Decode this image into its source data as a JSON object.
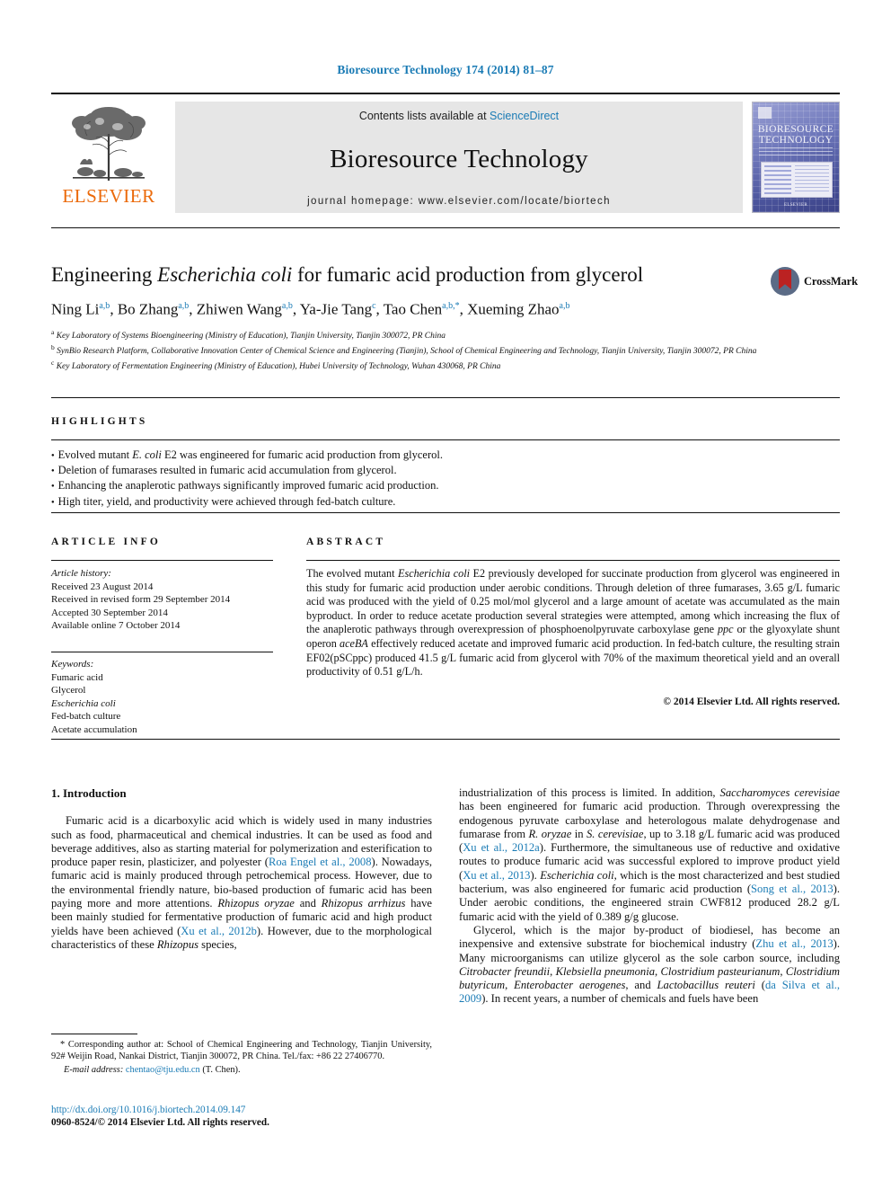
{
  "running_head": "Bioresource Technology 174 (2014) 81–87",
  "masthead": {
    "publisher": "ELSEVIER",
    "contents_prefix": "Contents lists available at ",
    "contents_link": "ScienceDirect",
    "journal_name": "Bioresource Technology",
    "homepage": "journal homepage: www.elsevier.com/locate/biortech",
    "cover": {
      "title_line1": "BIORESOURCE",
      "title_line2": "TECHNOLOGY",
      "footer": "ELSEVIER"
    }
  },
  "article": {
    "title_pre": "Engineering ",
    "title_italic": "Escherichia coli",
    "title_post": " for fumaric acid production from glycerol",
    "crossmark_label": "CrossMark",
    "authors": "Ning Li a,b, Bo Zhang a,b, Zhiwen Wang a,b, Ya-Jie Tang c, Tao Chen a,b,*, Xueming Zhao a,b",
    "affiliations": [
      "a Key Laboratory of Systems Bioengineering (Ministry of Education), Tianjin University, Tianjin 300072, PR China",
      "b SynBio Research Platform, Collaborative Innovation Center of Chemical Science and Engineering (Tianjin), School of Chemical Engineering and Technology, Tianjin University, Tianjin 300072, PR China",
      "c Key Laboratory of Fermentation Engineering (Ministry of Education), Hubei University of Technology, Wuhan 430068, PR China"
    ]
  },
  "highlights": {
    "heading": "HIGHLIGHTS",
    "items": [
      "Evolved mutant E. coli E2 was engineered for fumaric acid production from glycerol.",
      "Deletion of fumarases resulted in fumaric acid accumulation from glycerol.",
      "Enhancing the anaplerotic pathways significantly improved fumaric acid production.",
      "High titer, yield, and productivity were achieved through fed-batch culture."
    ]
  },
  "article_info": {
    "heading": "ARTICLE INFO",
    "history_label": "Article history:",
    "history": [
      "Received 23 August 2014",
      "Received in revised form 29 September 2014",
      "Accepted 30 September 2014",
      "Available online 7 October 2014"
    ],
    "keywords_label": "Keywords:",
    "keywords": [
      "Fumaric acid",
      "Glycerol",
      "Escherichia coli",
      "Fed-batch culture",
      "Acetate accumulation"
    ]
  },
  "abstract": {
    "heading": "ABSTRACT",
    "text": "The evolved mutant Escherichia coli E2 previously developed for succinate production from glycerol was engineered in this study for fumaric acid production under aerobic conditions. Through deletion of three fumarases, 3.65 g/L fumaric acid was produced with the yield of 0.25 mol/mol glycerol and a large amount of acetate was accumulated as the main byproduct. In order to reduce acetate production several strategies were attempted, among which increasing the flux of the anaplerotic pathways through overexpression of phosphoenolpyruvate carboxylase gene ppc or the glyoxylate shunt operon aceBA effectively reduced acetate and improved fumaric acid production. In fed-batch culture, the resulting strain EF02(pSCppc) produced 41.5 g/L fumaric acid from glycerol with 70% of the maximum theoretical yield and an overall productivity of 0.51 g/L/h.",
    "copyright": "© 2014 Elsevier Ltd. All rights reserved."
  },
  "introduction": {
    "heading": "1. Introduction",
    "left_paragraph": "Fumaric acid is a dicarboxylic acid which is widely used in many industries such as food, pharmaceutical and chemical industries. It can be used as food and beverage additives, also as starting material for polymerization and esterification to produce paper resin, plasticizer, and polyester (Roa Engel et al., 2008). Nowadays, fumaric acid is mainly produced through petrochemical process. However, due to the environmental friendly nature, bio-based production of fumaric acid has been paying more and more attentions. Rhizopus oryzae and Rhizopus arrhizus have been mainly studied for fermentative production of fumaric acid and high product yields have been achieved (Xu et al., 2012b). However, due to the morphological characteristics of these Rhizopus species,",
    "right_paragraph_1": "industrialization of this process is limited. In addition, Saccharomyces cerevisiae has been engineered for fumaric acid production. Through overexpressing the endogenous pyruvate carboxylase and heterologous malate dehydrogenase and fumarase from R. oryzae in S. cerevisiae, up to 3.18 g/L fumaric acid was produced (Xu et al., 2012a). Furthermore, the simultaneous use of reductive and oxidative routes to produce fumaric acid was successful explored to improve product yield (Xu et al., 2013). Escherichia coli, which is the most characterized and best studied bacterium, was also engineered for fumaric acid production (Song et al., 2013). Under aerobic conditions, the engineered strain CWF812 produced 28.2 g/L fumaric acid with the yield of 0.389 g/g glucose.",
    "right_paragraph_2": "Glycerol, which is the major by-product of biodiesel, has become an inexpensive and extensive substrate for biochemical industry (Zhu et al., 2013). Many microorganisms can utilize glycerol as the sole carbon source, including Citrobacter freundii, Klebsiella pneumonia, Clostridium pasteurianum, Clostridium butyricum, Enterobacter aerogenes, and Lactobacillus reuteri (da Silva et al., 2009). In recent years, a number of chemicals and fuels have been"
  },
  "footnote": {
    "corresponding": "* Corresponding author at: School of Chemical Engineering and Technology, Tianjin University, 92# Weijin Road, Nankai District, Tianjin 300072, PR China. Tel./fax: +86 22 27406770.",
    "email_label": "E-mail address:",
    "email": "chentao@tju.edu.cn",
    "email_suffix": " (T. Chen)."
  },
  "footer": {
    "doi": "http://dx.doi.org/10.1016/j.biortech.2014.09.147",
    "issn": "0960-8524/© 2014 Elsevier Ltd. All rights reserved."
  },
  "colors": {
    "link": "#1a7bb5",
    "elsevier_orange": "#eb6a0a",
    "band_grey": "#e6e6e6"
  }
}
